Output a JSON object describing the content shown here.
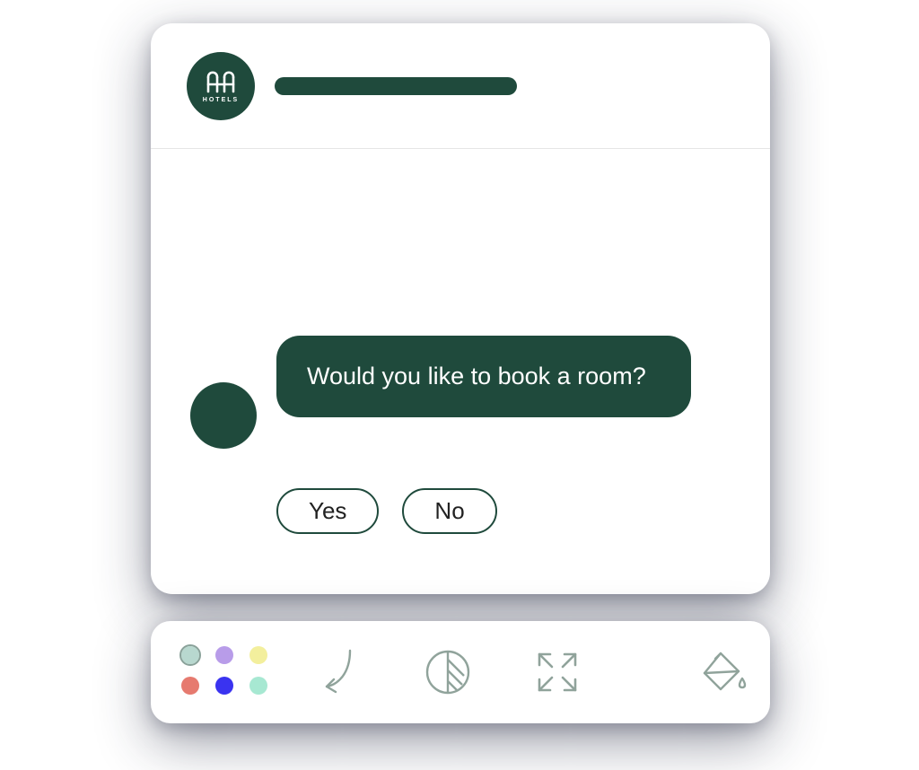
{
  "header": {
    "brand_icon": "hotels-logo-icon",
    "brand_sub": "HOTELS"
  },
  "chat": {
    "message": "Would you like to book a room?",
    "replies": {
      "yes": "Yes",
      "no": "No"
    }
  },
  "toolbar": {
    "palette": [
      {
        "name": "teal",
        "hex": "#b8d8cf",
        "selected": true
      },
      {
        "name": "violet",
        "hex": "#b89ce9",
        "selected": false
      },
      {
        "name": "yellow",
        "hex": "#f3ef9d",
        "selected": false
      },
      {
        "name": "red",
        "hex": "#e67a6f",
        "selected": false
      },
      {
        "name": "blue",
        "hex": "#3a33f0",
        "selected": false
      },
      {
        "name": "mint",
        "hex": "#a7e8d2",
        "selected": false
      }
    ],
    "icons": {
      "curve": "curve-arrow-icon",
      "contrast": "contrast-icon",
      "expand": "expand-icon",
      "fill": "paint-bucket-icon"
    }
  },
  "colors": {
    "brand": "#1f4a3c",
    "icon": "#90a39b"
  }
}
